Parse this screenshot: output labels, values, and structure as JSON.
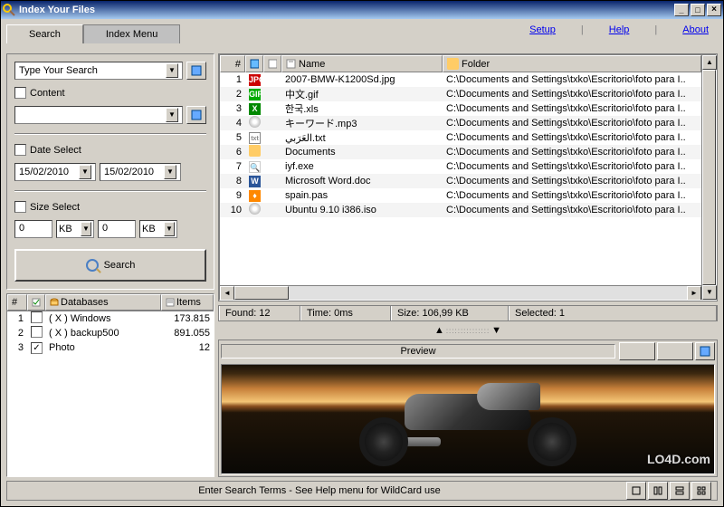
{
  "window": {
    "title": "Index Your Files"
  },
  "tabs": {
    "search": "Search",
    "index": "Index Menu"
  },
  "links": {
    "setup": "Setup",
    "help": "Help",
    "about": "About"
  },
  "search": {
    "placeholder": "Type Your Search",
    "content_label": "Content",
    "content_value": "",
    "date_label": "Date Select",
    "date_from": "15/02/2010",
    "date_to": "15/02/2010",
    "size_label": "Size Select",
    "size_from": "0",
    "size_to": "0",
    "unit_from": "KB",
    "unit_to": "KB",
    "button": "Search"
  },
  "db": {
    "headers": {
      "num": "#",
      "check": "",
      "name": "Databases",
      "items": "Items"
    },
    "rows": [
      {
        "num": "1",
        "checked": false,
        "name": "( X ) Windows",
        "items": "173.815"
      },
      {
        "num": "2",
        "checked": false,
        "name": "( X ) backup500",
        "items": "891.055"
      },
      {
        "num": "3",
        "checked": true,
        "name": "Photo",
        "items": "12"
      }
    ]
  },
  "results": {
    "headers": {
      "num": "#",
      "icon": "",
      "name": "Name",
      "folder": "Folder"
    },
    "rows": [
      {
        "num": "1",
        "icon": "jpg",
        "name": "2007-BMW-K1200Sd.jpg",
        "folder": "C:\\Documents and Settings\\txko\\Escritorio\\foto para I.."
      },
      {
        "num": "2",
        "icon": "gif",
        "name": "中文.gif",
        "folder": "C:\\Documents and Settings\\txko\\Escritorio\\foto para I.."
      },
      {
        "num": "3",
        "icon": "xls",
        "name": "한국.xls",
        "folder": "C:\\Documents and Settings\\txko\\Escritorio\\foto para I.."
      },
      {
        "num": "4",
        "icon": "cd",
        "name": "キーワード.mp3",
        "folder": "C:\\Documents and Settings\\txko\\Escritorio\\foto para I.."
      },
      {
        "num": "5",
        "icon": "txt",
        "name": "العَرَبي.txt",
        "folder": "C:\\Documents and Settings\\txko\\Escritorio\\foto para I.."
      },
      {
        "num": "6",
        "icon": "folder",
        "name": "Documents",
        "folder": "C:\\Documents and Settings\\txko\\Escritorio\\foto para I.."
      },
      {
        "num": "7",
        "icon": "exe",
        "name": "iyf.exe",
        "folder": "C:\\Documents and Settings\\txko\\Escritorio\\foto para I.."
      },
      {
        "num": "8",
        "icon": "doc",
        "name": "Microsoft Word.doc",
        "folder": "C:\\Documents and Settings\\txko\\Escritorio\\foto para I.."
      },
      {
        "num": "9",
        "icon": "pas",
        "name": "spain.pas",
        "folder": "C:\\Documents and Settings\\txko\\Escritorio\\foto para I.."
      },
      {
        "num": "10",
        "icon": "cd",
        "name": "Ubuntu 9.10 i386.iso",
        "folder": "C:\\Documents and Settings\\txko\\Escritorio\\foto para I.."
      }
    ]
  },
  "status": {
    "found": "Found: 12",
    "time": "Time:   0ms",
    "size": "Size: 106,99 KB",
    "selected": "Selected: 1"
  },
  "preview": {
    "title": "Preview"
  },
  "bottom": {
    "msg": "Enter Search Terms - See Help menu for WildCard use"
  },
  "watermark": "LO4D.com"
}
